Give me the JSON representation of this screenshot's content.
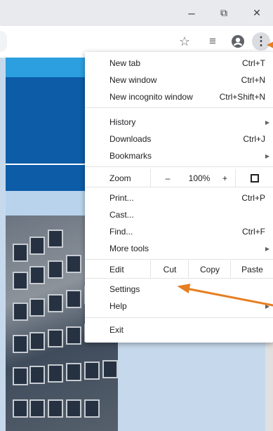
{
  "window_controls": {
    "minimize_glyph": "–",
    "maximize_glyph": "⧉",
    "close_glyph": "✕"
  },
  "toolbar": {
    "star_glyph": "☆",
    "media_glyph": "≡",
    "profile_glyph": "●",
    "menu_glyph": "⋮"
  },
  "menu": {
    "new_tab": {
      "label": "New tab",
      "shortcut": "Ctrl+T"
    },
    "new_window": {
      "label": "New window",
      "shortcut": "Ctrl+N"
    },
    "new_incognito": {
      "label": "New incognito window",
      "shortcut": "Ctrl+Shift+N"
    },
    "history": {
      "label": "History"
    },
    "downloads": {
      "label": "Downloads",
      "shortcut": "Ctrl+J"
    },
    "bookmarks": {
      "label": "Bookmarks"
    },
    "zoom": {
      "label": "Zoom",
      "minus": "–",
      "value": "100%",
      "plus": "+"
    },
    "print": {
      "label": "Print...",
      "shortcut": "Ctrl+P"
    },
    "cast": {
      "label": "Cast..."
    },
    "find": {
      "label": "Find...",
      "shortcut": "Ctrl+F"
    },
    "more_tools": {
      "label": "More tools"
    },
    "edit": {
      "label": "Edit",
      "cut": "Cut",
      "copy": "Copy",
      "paste": "Paste"
    },
    "settings": {
      "label": "Settings"
    },
    "help": {
      "label": "Help"
    },
    "exit": {
      "label": "Exit"
    },
    "submenu_arrow": "▶"
  },
  "colors": {
    "annotation": "#e67e22",
    "page_blue_light": "#2b9fe0",
    "page_blue_dark": "#0c5ca8",
    "page_blue_pale": "#c6d9ec"
  }
}
